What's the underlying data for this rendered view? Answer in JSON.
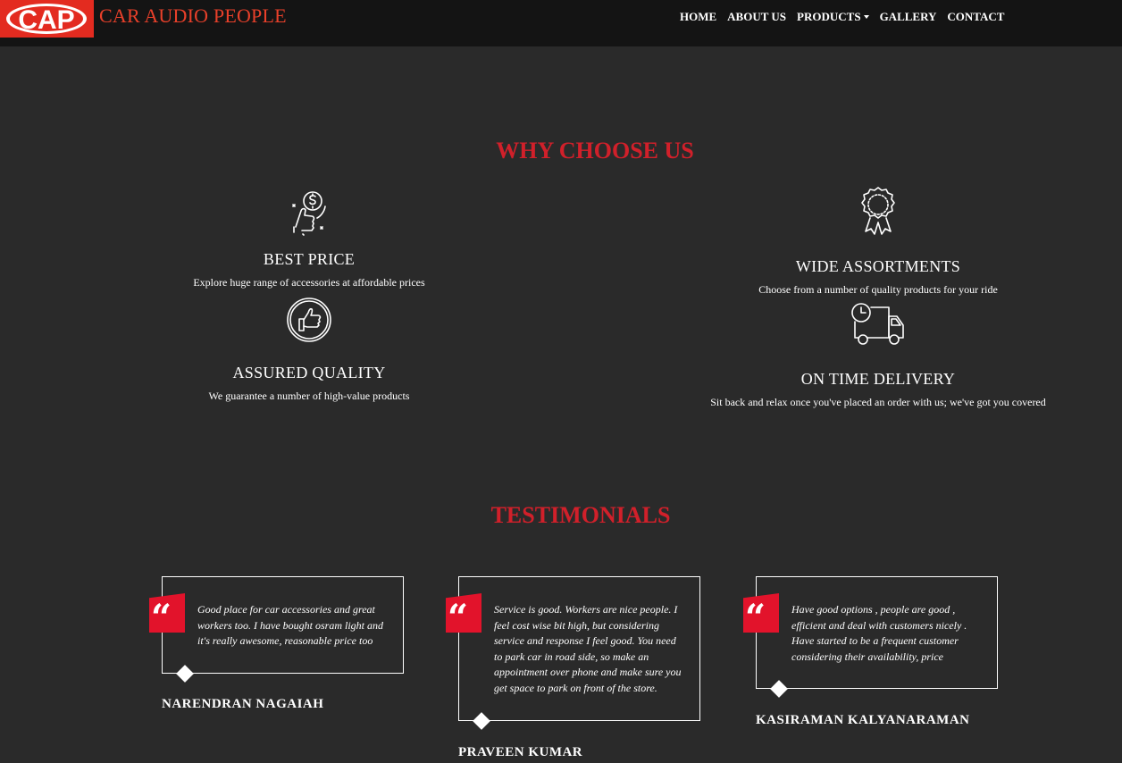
{
  "brand": {
    "logo_text": "CAP",
    "name": "CAR AUDIO PEOPLE"
  },
  "nav": {
    "items": [
      {
        "label": "HOME"
      },
      {
        "label": "ABOUT US"
      },
      {
        "label": "PRODUCTS"
      },
      {
        "label": "GALLERY"
      },
      {
        "label": "CONTACT"
      }
    ]
  },
  "why": {
    "title": "WHY CHOOSE US",
    "features": [
      {
        "icon": "price-hand-icon",
        "title": "BEST PRICE",
        "desc": "Explore huge range of accessories at affordable prices"
      },
      {
        "icon": "award-badge-icon",
        "title": "WIDE ASSORTMENTS",
        "desc": "Choose from a number of quality products for your ride"
      },
      {
        "icon": "thumbs-up-icon",
        "title": "ASSURED QUALITY",
        "desc": "We guarantee a number of high-value products"
      },
      {
        "icon": "delivery-truck-icon",
        "title": "ON TIME DELIVERY",
        "desc": "Sit back and relax once you've placed an order with us; we've got you covered"
      }
    ]
  },
  "testimonials": {
    "title": "TESTIMONIALS",
    "items": [
      {
        "text": "Good place for car accessories and great workers too. I have bought osram light and it's really awesome, reasonable price too",
        "name": "NARENDRAN NAGAIAH"
      },
      {
        "text": "Service is good. Workers are nice people. I feel cost wise bit high, but considering service and response I feel good. You need to park car in road side, so make an appointment over phone and make sure you get space to park on front of the store.",
        "name": "PRAVEEN KUMAR"
      },
      {
        "text": "Have good options , people are good , efficient and deal with customers nicely . Have started to be a frequent customer considering their availability, price",
        "name": "KASIRAMAN KALYANARAMAN"
      }
    ]
  },
  "colors": {
    "accent_red": "#d1202a",
    "logo_red": "#e32b20",
    "background": "#2a2a2a",
    "navbar": "#141414"
  }
}
